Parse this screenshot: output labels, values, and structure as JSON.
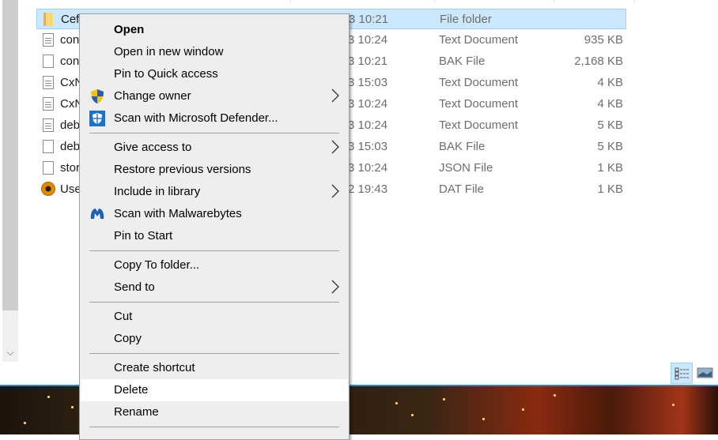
{
  "file_list": {
    "rows": [
      {
        "name": "Cef",
        "date": "3 10:21",
        "type": "File folder",
        "size": "",
        "icon": "folder-icon",
        "selected": true
      },
      {
        "name": "con",
        "date": "3 10:24",
        "type": "Text Document",
        "size": "935 KB",
        "icon": "text-document-icon"
      },
      {
        "name": "con",
        "date": "3 10:21",
        "type": "BAK File",
        "size": "2,168 KB",
        "icon": "blank-file-icon"
      },
      {
        "name": "CxN",
        "date": "3 15:03",
        "type": "Text Document",
        "size": "4 KB",
        "icon": "text-document-icon"
      },
      {
        "name": "CxN",
        "date": "3 10:24",
        "type": "Text Document",
        "size": "4 KB",
        "icon": "text-document-icon"
      },
      {
        "name": "deb",
        "date": "3 10:24",
        "type": "Text Document",
        "size": "5 KB",
        "icon": "text-document-icon"
      },
      {
        "name": "deb",
        "date": "3 15:03",
        "type": "BAK File",
        "size": "5 KB",
        "icon": "blank-file-icon"
      },
      {
        "name": "stor",
        "date": "3 10:24",
        "type": "JSON File",
        "size": "1 KB",
        "icon": "blank-file-icon"
      },
      {
        "name": "Use",
        "date": "2 19:43",
        "type": "DAT File",
        "size": "1 KB",
        "icon": "dat-file-icon"
      }
    ]
  },
  "context_menu": {
    "items": [
      {
        "label": "Open",
        "bold": true
      },
      {
        "label": "Open in new window"
      },
      {
        "label": "Pin to Quick access"
      },
      {
        "label": "Change owner",
        "icon": "uac-shield-icon",
        "submenu": true
      },
      {
        "label": "Scan with Microsoft Defender...",
        "icon": "defender-icon"
      },
      {
        "label": "Give access to",
        "submenu": true
      },
      {
        "label": "Restore previous versions"
      },
      {
        "label": "Include in library",
        "submenu": true
      },
      {
        "label": "Scan with Malwarebytes",
        "icon": "malwarebytes-icon"
      },
      {
        "label": "Pin to Start"
      },
      {
        "label": "Copy To folder..."
      },
      {
        "label": "Send to",
        "submenu": true
      },
      {
        "label": "Cut"
      },
      {
        "label": "Copy"
      },
      {
        "label": "Create shortcut"
      },
      {
        "label": "Delete",
        "highlighted": true
      },
      {
        "label": "Rename"
      }
    ]
  },
  "status_bar": {
    "view_details_label": "Details view",
    "view_large_icons_label": "Large icons view"
  },
  "colors": {
    "selection": "#cce8ff",
    "selection_border": "#99d1ff",
    "menu_bg": "#eeeeee",
    "accent": "#1a8fd8"
  }
}
